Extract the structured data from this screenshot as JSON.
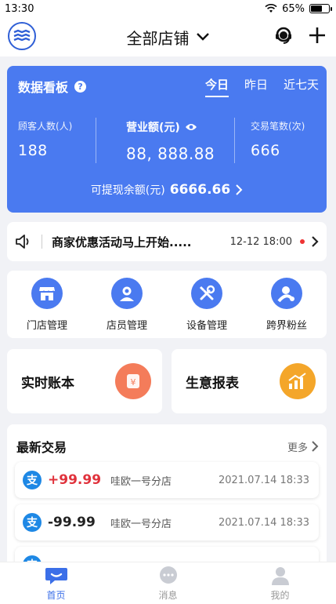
{
  "status_bar": {
    "time": "13:30",
    "battery": "65%",
    "battery_level": 0.65
  },
  "header": {
    "title": "全部店铺",
    "logo_icon": "brand-logo",
    "service_icon": "customer-service-icon",
    "add_icon": "plus-icon"
  },
  "dashboard": {
    "title": "数据看板",
    "tabs": [
      "今日",
      "昨日",
      "近七天"
    ],
    "active_tab": "今日",
    "metrics": [
      {
        "label": "顾客人数(人)",
        "value": "188"
      },
      {
        "label": "营业额(元)",
        "value": "88, 888.88"
      },
      {
        "label": "交易笔数(次)",
        "value": "666"
      }
    ],
    "balance_label": "可提现余额(元)",
    "balance_value": "6666.66"
  },
  "notice": {
    "text": "商家优惠活动马上开始.....",
    "time": "12-12 18:00"
  },
  "actions": [
    {
      "label": "门店管理",
      "icon": "store-icon"
    },
    {
      "label": "店员管理",
      "icon": "staff-icon"
    },
    {
      "label": "设备管理",
      "icon": "tools-icon"
    },
    {
      "label": "跨界粉丝",
      "icon": "fans-icon"
    }
  ],
  "cards": [
    {
      "label": "实时账本",
      "icon": "ledger-icon",
      "color": "#f47c5a"
    },
    {
      "label": "生意报表",
      "icon": "report-chart-icon",
      "color": "#f4a62a"
    }
  ],
  "recent": {
    "title": "最新交易",
    "more": "更多",
    "items": [
      {
        "amount": "+99.99",
        "store": "哇欧一号分店",
        "date": "2021.07.14 18:33",
        "amount_color": "#e0323c"
      },
      {
        "amount": "-99.99",
        "store": "哇欧一号分店",
        "date": "2021.07.14 18:33",
        "amount_color": "#222222"
      }
    ]
  },
  "bottom_nav": [
    {
      "label": "首页",
      "icon": "home-chat-icon",
      "active": true
    },
    {
      "label": "消息",
      "icon": "message-icon",
      "active": false
    },
    {
      "label": "我的",
      "icon": "profile-icon",
      "active": false
    }
  ],
  "colors": {
    "primary": "#4a7af0",
    "active_nav": "#3b6fe8",
    "alert_red": "#e33333"
  }
}
